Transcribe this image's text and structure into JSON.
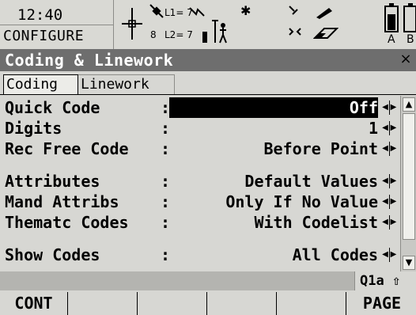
{
  "status": {
    "time": "12:40",
    "mode": "CONFIGURE",
    "satellites_count": "8",
    "l1_count": "L1= 7",
    "l2_count": "L2= 7",
    "icons": [
      "crosshair-icon",
      "satellite-icon",
      "antenna-height-icon",
      "bluetooth-icon",
      "radio-icon",
      "pen-icon",
      "battery-icon"
    ],
    "battery_labels": [
      "A",
      "B"
    ]
  },
  "window": {
    "title": "Coding & Linework",
    "close_glyph": "×"
  },
  "tabs": [
    {
      "label": "Coding",
      "active": true
    },
    {
      "label": "Linework",
      "active": false
    }
  ],
  "fields": [
    {
      "label": "Quick Code",
      "value": "Off",
      "selected": true
    },
    {
      "label": "Digits",
      "value": "1",
      "selected": false
    },
    {
      "label": "Rec Free Code",
      "value": "Before Point",
      "selected": false
    },
    {
      "label": "Attributes",
      "value": "Default Values",
      "selected": false
    },
    {
      "label": "Mand Attribs",
      "value": "Only If No Value",
      "selected": false
    },
    {
      "label": "Thematc Codes",
      "value": "With Codelist",
      "selected": false
    },
    {
      "label": "Show Codes",
      "value": "All Codes",
      "selected": false
    }
  ],
  "input_mode": "Q1a ⇧",
  "softkeys": [
    "CONT",
    "",
    "",
    "",
    "",
    "PAGE"
  ],
  "colors": {
    "title_bar": "#6e6e6e",
    "background": "#d7d7d3",
    "selection": "#000000"
  }
}
